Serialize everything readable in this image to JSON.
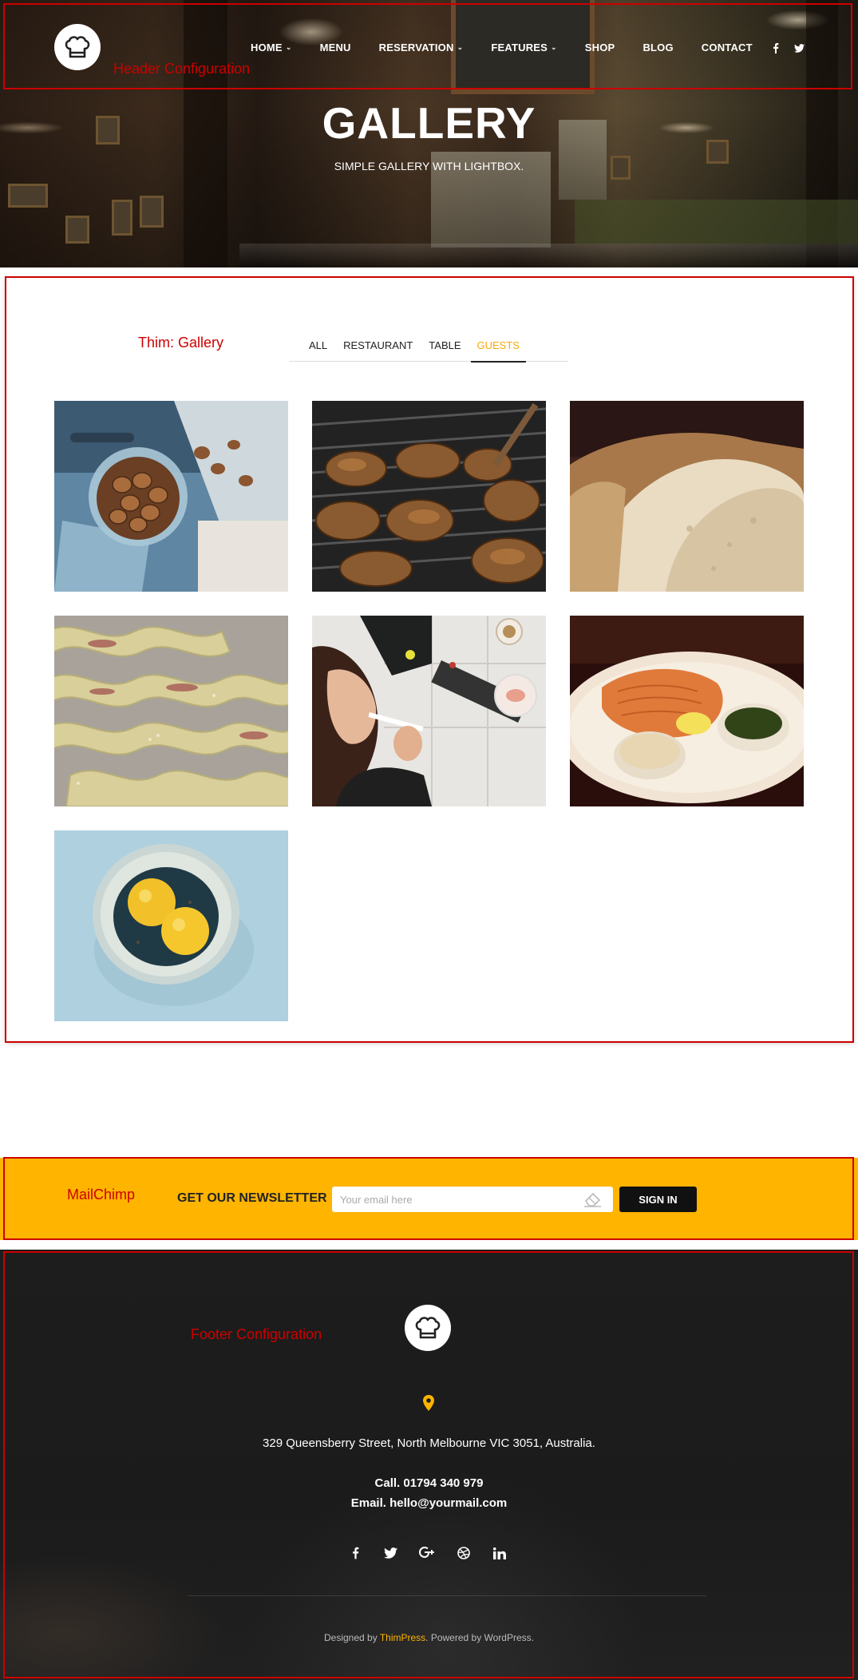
{
  "header": {
    "nav": [
      {
        "label": "HOME",
        "dropdown": true
      },
      {
        "label": "MENU",
        "dropdown": false
      },
      {
        "label": "RESERVATION",
        "dropdown": true
      },
      {
        "label": "FEATURES",
        "dropdown": true
      },
      {
        "label": "SHOP",
        "dropdown": false
      },
      {
        "label": "BLOG",
        "dropdown": false
      },
      {
        "label": "CONTACT",
        "dropdown": false
      }
    ],
    "social": [
      "facebook-icon",
      "twitter-icon"
    ],
    "annotation": "Header Configuration"
  },
  "hero": {
    "title": "GALLERY",
    "subtitle": "SIMPLE GALLERY WITH LIGHTBOX."
  },
  "gallery": {
    "annotation": "Thim: Gallery",
    "filters": [
      "ALL",
      "RESTAURANT",
      "TABLE",
      "GUESTS"
    ],
    "active_filter": "GUESTS",
    "images": [
      "walnuts",
      "grilled-meat",
      "bread",
      "pastry-rolls",
      "woman-eating",
      "salmon-plate",
      "lemons-bowl"
    ]
  },
  "newsletter": {
    "annotation": "MailChimp",
    "title": "GET OUR NEWSLETTER",
    "placeholder": "Your email here",
    "button": "SIGN IN"
  },
  "footer": {
    "annotation": "Footer Configuration",
    "address": "329 Queensberry Street, North Melbourne VIC 3051, Australia.",
    "phone": "Call. 01794 340 979",
    "email": "Email. hello@yourmail.com",
    "social": [
      "facebook-icon",
      "twitter-icon",
      "google-plus-icon",
      "dribbble-icon",
      "linkedin-icon"
    ],
    "credit_prefix": "Designed by ",
    "credit_link": "ThimPress",
    "credit_suffix": ". Powered by WordPress."
  },
  "colors": {
    "accent": "#ffb400",
    "active_filter": "#f5a90c",
    "annotation": "#cc0000",
    "footer_bg": "#1d1d1d"
  }
}
